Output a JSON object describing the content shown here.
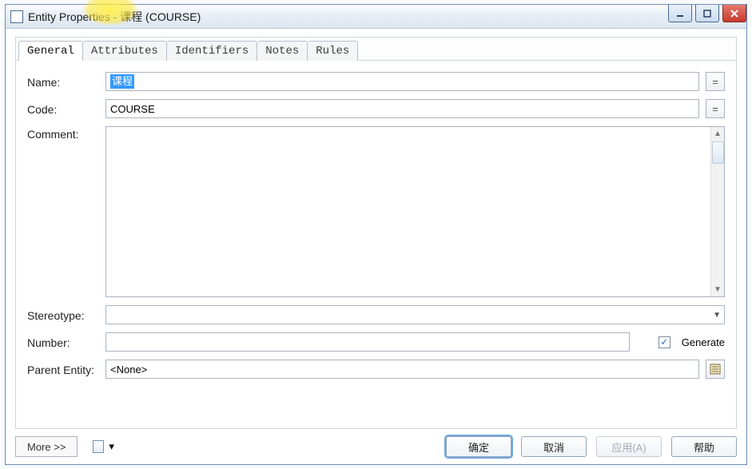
{
  "window": {
    "title": "Entity Properties - 课程 (COURSE)"
  },
  "tabs": {
    "general": "General",
    "attributes": "Attributes",
    "identifiers": "Identifiers",
    "notes": "Notes",
    "rules": "Rules"
  },
  "labels": {
    "name": "Name:",
    "code": "Code:",
    "comment": "Comment:",
    "stereotype": "Stereotype:",
    "number": "Number:",
    "generate": "Generate",
    "parent_entity": "Parent Entity:",
    "equals": "="
  },
  "fields": {
    "name": "课程",
    "code": "COURSE",
    "comment": "",
    "stereotype": "",
    "number": "",
    "generate_checked": "✓",
    "parent_entity": "<None>"
  },
  "footer": {
    "more": "More >>",
    "dropdown_caret": "▾",
    "ok": "确定",
    "cancel": "取消",
    "apply": "应用(A)",
    "help": "帮助"
  }
}
